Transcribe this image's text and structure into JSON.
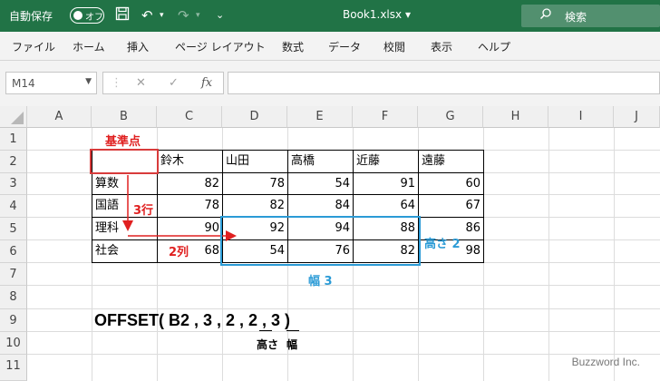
{
  "titlebar": {
    "autosave_label": "自動保存",
    "toggle_state": "オフ",
    "title": "Book1.xlsx",
    "title_caret": "▾",
    "search_placeholder": "検索"
  },
  "menu": [
    "ファイル",
    "ホーム",
    "挿入",
    "ページ レイアウト",
    "数式",
    "データ",
    "校閲",
    "表示",
    "ヘルプ"
  ],
  "formula_bar": {
    "name_box": "M14",
    "formula": ""
  },
  "columns": [
    "A",
    "B",
    "C",
    "D",
    "E",
    "F",
    "G",
    "H",
    "I",
    "J"
  ],
  "rows": [
    "1",
    "2",
    "3",
    "4",
    "5",
    "6",
    "7",
    "8",
    "9",
    "10",
    "11"
  ],
  "table": {
    "headers": [
      "鈴木",
      "山田",
      "高橋",
      "近藤",
      "遠藤"
    ],
    "subjects": [
      "算数",
      "国語",
      "理科",
      "社会"
    ],
    "values": [
      [
        "82",
        "78",
        "54",
        "91",
        "60"
      ],
      [
        "78",
        "82",
        "84",
        "64",
        "67"
      ],
      [
        "90",
        "92",
        "94",
        "88",
        "86"
      ],
      [
        "68",
        "54",
        "76",
        "82",
        "98"
      ]
    ]
  },
  "annotations": {
    "base_point": "基準点",
    "rows_offset": "3行",
    "cols_offset": "2列",
    "height": "高さ 2",
    "width": "幅 3",
    "formula_text": "OFFSET( B2 , 3 , 2 , 2 , 3 )",
    "label_height": "高さ",
    "label_width": "幅",
    "watermark": "Buzzword Inc."
  },
  "colors": {
    "excel_green": "#217346",
    "red": "#e02020",
    "blue": "#2b9bd6"
  }
}
